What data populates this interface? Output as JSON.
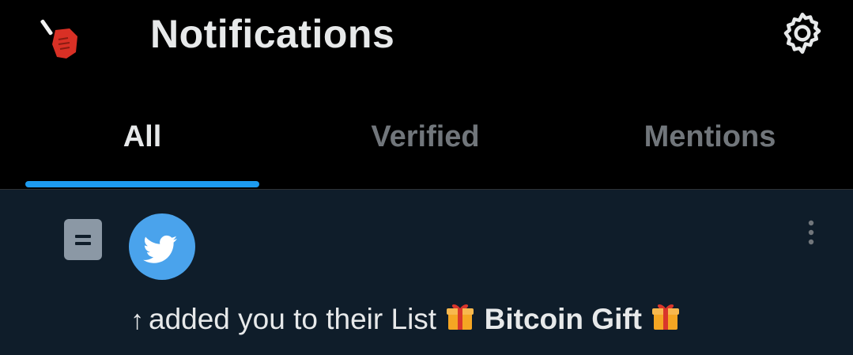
{
  "header": {
    "title": "Notifications"
  },
  "tabs": [
    {
      "label": "All",
      "active": true
    },
    {
      "label": "Verified",
      "active": false
    },
    {
      "label": "Mentions",
      "active": false
    }
  ],
  "notification": {
    "prefix_symbol": "↑",
    "text": "added you to their List",
    "list_name": "Bitcoin Gift"
  },
  "icons": {
    "profile_avatar": "raised-fist-avatar-icon",
    "settings": "gear-icon",
    "list": "list-icon",
    "avatar": "twitter-bird-icon",
    "more": "more-vertical-icon",
    "gift": "gift-icon"
  },
  "colors": {
    "background": "#000000",
    "notification_bg": "#0f1d2a",
    "accent": "#1d9bf0",
    "text": "#e7e9ea",
    "muted": "#71767b",
    "avatar_bg": "#4aa3ec"
  }
}
